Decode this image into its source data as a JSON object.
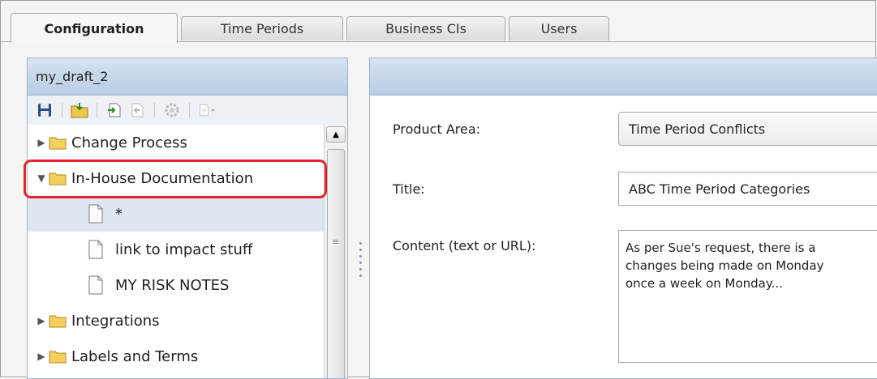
{
  "tabs": [
    {
      "label": "Configuration",
      "active": true
    },
    {
      "label": "Time Periods",
      "active": false
    },
    {
      "label": "Business CIs",
      "active": false
    },
    {
      "label": "Users",
      "active": false
    }
  ],
  "left_panel": {
    "title": "my_draft_2",
    "toolbar_icons": [
      "save-icon",
      "import-folder-icon",
      "import-icon",
      "export-icon",
      "settings-icon",
      "add-document-icon"
    ],
    "tree": [
      {
        "label": "Change Process",
        "type": "folder",
        "expanded": false
      },
      {
        "label": "In-House Documentation",
        "type": "folder",
        "expanded": true,
        "highlighted": true
      },
      {
        "label": "*",
        "type": "document",
        "selected": true
      },
      {
        "label": "link to impact stuff",
        "type": "document"
      },
      {
        "label": "MY RISK NOTES",
        "type": "document"
      },
      {
        "label": "Integrations",
        "type": "folder",
        "expanded": false
      },
      {
        "label": "Labels and Terms",
        "type": "folder",
        "expanded": false
      }
    ]
  },
  "right_panel": {
    "title": "",
    "product_area_label": "Product Area:",
    "product_area_value": "Time Period Conflicts",
    "title_label": "Title:",
    "title_value": "ABC Time Period Categories",
    "content_label": "Content (text or URL):",
    "content_value": "As per Sue's request, there is a\nchanges being made on Monday\nonce a week on Monday..."
  },
  "colors": {
    "highlight": "#e2242b",
    "header": "#c8d8ea",
    "selection": "#dde6f1"
  }
}
